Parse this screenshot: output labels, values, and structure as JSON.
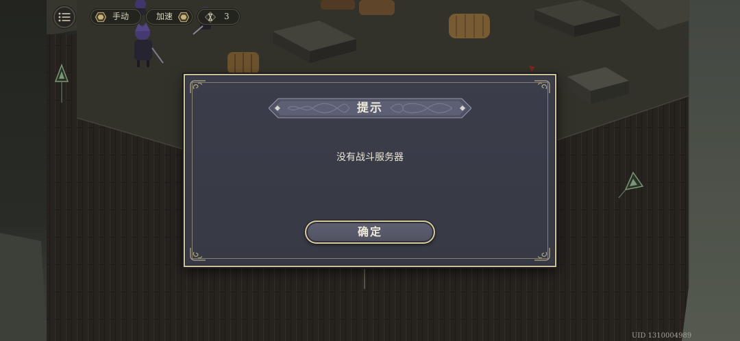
{
  "hud": {
    "menu": {
      "icon": "list-icon"
    },
    "mode": {
      "label": "手动",
      "icon": "hexagon-icon"
    },
    "speed": {
      "label": "加速",
      "icon": "hexagon-icon"
    },
    "turn": {
      "icon": "hourglass-icon",
      "value": "3"
    }
  },
  "map": {
    "marker_icon": "waypoint-marker-icon"
  },
  "dialog": {
    "title": "提示",
    "message": "没有战斗服务器",
    "confirm_label": "确定"
  },
  "footer": {
    "uid": "UID 1310004989"
  },
  "colors": {
    "dialog_bg": "#3b3d4a",
    "dialog_border": "#cfc39a",
    "banner_bg": "#5d6074",
    "button_bg": "#57596a",
    "text": "#efe9d8",
    "marker": "#8aa985"
  }
}
